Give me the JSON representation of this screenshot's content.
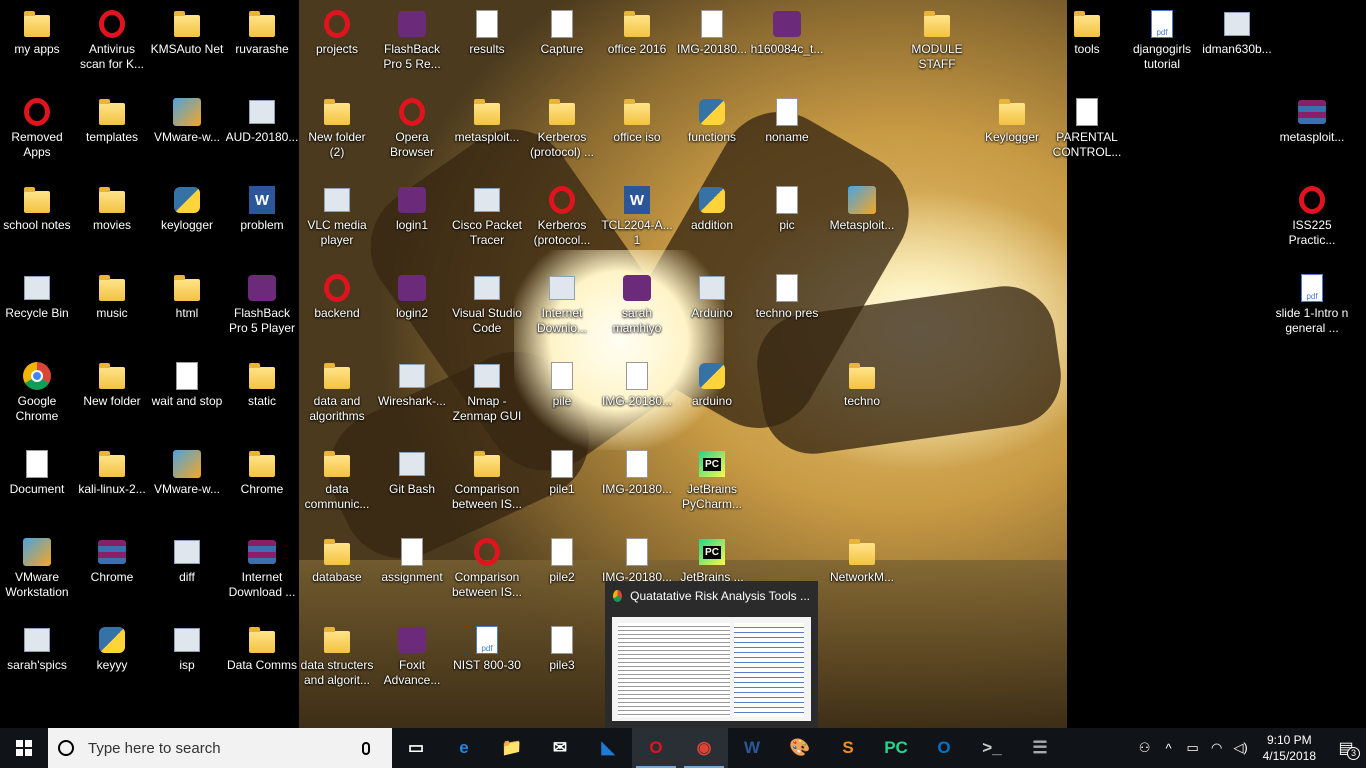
{
  "desktop": {
    "icons": [
      {
        "label": "my apps",
        "type": "folder"
      },
      {
        "label": "Antivirus scan for K...",
        "type": "opera"
      },
      {
        "label": "KMSAuto Net",
        "type": "folder"
      },
      {
        "label": "ruvarashe",
        "type": "folder"
      },
      {
        "label": "projects",
        "type": "opera"
      },
      {
        "label": "FlashBack Pro 5 Re...",
        "type": "flash"
      },
      {
        "label": "results",
        "type": "doc"
      },
      {
        "label": "Capture",
        "type": "doc"
      },
      {
        "label": "office 2016",
        "type": "folder"
      },
      {
        "label": "IMG-20180...",
        "type": "doc"
      },
      {
        "label": "h160084c_t...",
        "type": "flash"
      },
      {
        "label": "MODULE STAFF",
        "type": "folder"
      },
      {
        "label": "tools",
        "type": "folder"
      },
      {
        "label": "djangogirls tutorial",
        "type": "pdf"
      },
      {
        "label": "idman630b...",
        "type": "generic"
      },
      {
        "label": "Removed Apps",
        "type": "opera"
      },
      {
        "label": "templates",
        "type": "folder"
      },
      {
        "label": "VMware-w...",
        "type": "vmware"
      },
      {
        "label": "AUD-20180...",
        "type": "generic"
      },
      {
        "label": "New folder (2)",
        "type": "folder"
      },
      {
        "label": "Opera Browser",
        "type": "opera"
      },
      {
        "label": "metasploit...",
        "type": "folder"
      },
      {
        "label": "Kerberos (protocol) ...",
        "type": "folder"
      },
      {
        "label": "office iso",
        "type": "folder"
      },
      {
        "label": "functions",
        "type": "python"
      },
      {
        "label": "noname",
        "type": "doc"
      },
      {
        "label": "Keylogger",
        "type": "folder"
      },
      {
        "label": "PARENTAL CONTROL...",
        "type": "doc"
      },
      {
        "label": "metasploit...",
        "type": "winrar"
      },
      {
        "label": "school notes",
        "type": "folder"
      },
      {
        "label": "movies",
        "type": "folder"
      },
      {
        "label": "keylogger",
        "type": "python"
      },
      {
        "label": "problem",
        "type": "word"
      },
      {
        "label": "VLC media player",
        "type": "generic"
      },
      {
        "label": "login1",
        "type": "flash"
      },
      {
        "label": "Cisco Packet Tracer",
        "type": "generic"
      },
      {
        "label": "Kerberos (protocol...",
        "type": "opera"
      },
      {
        "label": "TCL2204-A... 1",
        "type": "word"
      },
      {
        "label": "addition",
        "type": "python"
      },
      {
        "label": "pic",
        "type": "doc"
      },
      {
        "label": "Metasploit...",
        "type": "vmware"
      },
      {
        "label": "ISS225 Practic...",
        "type": "opera"
      },
      {
        "label": "Recycle Bin",
        "type": "generic"
      },
      {
        "label": "music",
        "type": "folder"
      },
      {
        "label": "html",
        "type": "folder"
      },
      {
        "label": "FlashBack Pro 5 Player",
        "type": "flash"
      },
      {
        "label": "backend",
        "type": "opera"
      },
      {
        "label": "login2",
        "type": "flash"
      },
      {
        "label": "Visual Studio Code",
        "type": "generic"
      },
      {
        "label": "Internet Downlo...",
        "type": "generic"
      },
      {
        "label": "sarah mamhiyo",
        "type": "flash"
      },
      {
        "label": "Arduino",
        "type": "generic"
      },
      {
        "label": "techno pres",
        "type": "doc"
      },
      {
        "label": "slide 1-Intro n general ...",
        "type": "pdf"
      },
      {
        "label": "Google Chrome",
        "type": "chrome"
      },
      {
        "label": "New folder",
        "type": "folder"
      },
      {
        "label": "wait and stop",
        "type": "doc"
      },
      {
        "label": "static",
        "type": "folder"
      },
      {
        "label": "data and algorithms",
        "type": "folder"
      },
      {
        "label": "Wireshark-...",
        "type": "generic"
      },
      {
        "label": "Nmap - Zenmap GUI",
        "type": "generic"
      },
      {
        "label": "pile",
        "type": "doc"
      },
      {
        "label": "IMG-20180...",
        "type": "doc"
      },
      {
        "label": "arduino",
        "type": "python"
      },
      {
        "label": "techno",
        "type": "folder"
      },
      {
        "label": "Document",
        "type": "doc"
      },
      {
        "label": "kali-linux-2...",
        "type": "folder"
      },
      {
        "label": "VMware-w...",
        "type": "vmware"
      },
      {
        "label": "Chrome",
        "type": "folder"
      },
      {
        "label": "data communic...",
        "type": "folder"
      },
      {
        "label": "Git Bash",
        "type": "generic"
      },
      {
        "label": "Comparison between IS...",
        "type": "folder"
      },
      {
        "label": "pile1",
        "type": "doc"
      },
      {
        "label": "IMG-20180...",
        "type": "doc"
      },
      {
        "label": "JetBrains PyCharm...",
        "type": "jb"
      },
      {
        "label": "VMware Workstation",
        "type": "vmware"
      },
      {
        "label": "Chrome",
        "type": "winrar"
      },
      {
        "label": "diff",
        "type": "generic"
      },
      {
        "label": "Internet Download ...",
        "type": "winrar"
      },
      {
        "label": "database",
        "type": "folder"
      },
      {
        "label": "assignment",
        "type": "doc"
      },
      {
        "label": "Comparison between IS...",
        "type": "opera"
      },
      {
        "label": "pile2",
        "type": "doc"
      },
      {
        "label": "IMG-20180...",
        "type": "doc"
      },
      {
        "label": "JetBrains ...",
        "type": "jb"
      },
      {
        "label": "NetworkM...",
        "type": "folder"
      },
      {
        "label": "sarah'spics",
        "type": "generic"
      },
      {
        "label": "keyyy",
        "type": "python"
      },
      {
        "label": "isp",
        "type": "generic"
      },
      {
        "label": "Data Comms",
        "type": "folder"
      },
      {
        "label": "data structers and algorit...",
        "type": "folder"
      },
      {
        "label": "Foxit Advance...",
        "type": "flash"
      },
      {
        "label": "NIST 800-30",
        "type": "pdf"
      },
      {
        "label": "pile3",
        "type": "doc"
      }
    ]
  },
  "preview": {
    "title": "Quatatative Risk Analysis Tools ..."
  },
  "taskbar": {
    "search_placeholder": "Type here to search",
    "apps": [
      {
        "name": "task-view",
        "glyph": "▭"
      },
      {
        "name": "edge",
        "glyph": "e"
      },
      {
        "name": "file-explorer",
        "glyph": "📁"
      },
      {
        "name": "mail",
        "glyph": "✉"
      },
      {
        "name": "wireshark",
        "glyph": "◣"
      },
      {
        "name": "opera",
        "glyph": "O"
      },
      {
        "name": "chrome",
        "glyph": "◉"
      },
      {
        "name": "word",
        "glyph": "W"
      },
      {
        "name": "paint",
        "glyph": "🎨"
      },
      {
        "name": "sublime",
        "glyph": "S"
      },
      {
        "name": "pycharm",
        "glyph": "PC"
      },
      {
        "name": "outlook",
        "glyph": "O"
      },
      {
        "name": "cmd",
        "glyph": ">_"
      },
      {
        "name": "database",
        "glyph": "☰"
      }
    ],
    "time": "9:10 PM",
    "date": "4/15/2018",
    "notifications": "3"
  }
}
